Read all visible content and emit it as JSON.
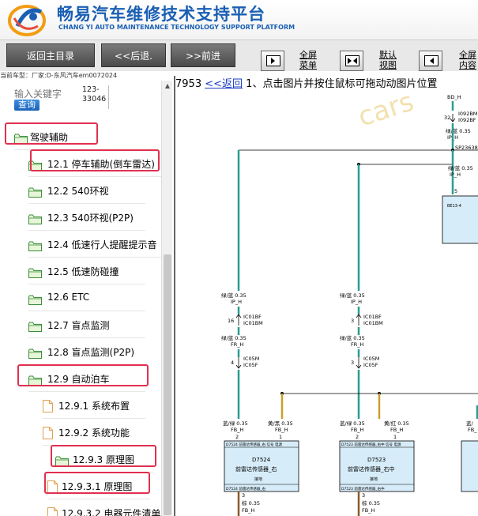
{
  "header": {
    "title_cn": "畅易汽车维修技术支持平台",
    "title_en": "CHANG YI AUTO MAINTENANCE TECHNOLOGY SUPPORT PLATFORM"
  },
  "toolbar": {
    "main_menu": "返回主目录",
    "back": "<<后退.",
    "forward": ">>前进",
    "full_menu": [
      "全屏",
      "菜单"
    ],
    "default_view": [
      "默认",
      "视图"
    ],
    "full_content": [
      "全屏",
      "内容"
    ]
  },
  "car_info": "当前车型：厂家:D-东风汽车em0072024",
  "search": {
    "placeholder": "输入关键字",
    "button": "查询",
    "note": "123-33046"
  },
  "tree": [
    {
      "label": "驾驶辅助",
      "highlight": true
    },
    {
      "label": "12.1 停车辅助(倒车雷达)",
      "highlight": true
    },
    {
      "label": "12.2 540环视",
      "highlight": false
    },
    {
      "label": "12.3 540环视(P2P)",
      "highlight": false
    },
    {
      "label": "12.4 低速行人提醒提示音",
      "highlight": false
    },
    {
      "label": "12.5 低速防碰撞",
      "highlight": false
    },
    {
      "label": "12.6 ETC",
      "highlight": false
    },
    {
      "label": "12.7 盲点监测",
      "highlight": false
    },
    {
      "label": "12.8 盲点监测(P2P)",
      "highlight": false
    },
    {
      "label": "12.9 自动泊车",
      "highlight": true
    },
    {
      "label": "12.9.1 系统布置",
      "highlight": false
    },
    {
      "label": "12.9.2 系统功能",
      "highlight": false
    },
    {
      "label": "12.9.3 原理图",
      "highlight": true
    },
    {
      "label": "12.9.3.1 原理图",
      "highlight": true
    },
    {
      "label": "12.9.3.2 电器元件清单",
      "highlight": false
    }
  ],
  "main": {
    "page_num": "7953",
    "back_link": "<<返回",
    "instruction": "1、点击图片并按住鼠标可拖动动图片位置"
  },
  "diagram": {
    "watermark": "cars",
    "top_labels": [
      "BD_H",
      "32",
      "I092BM",
      "I092BF",
      "绿/蓝 0.35",
      "IP_H",
      "SP23638"
    ],
    "ecu_labels": [
      "绿/蓝 0.35",
      "IP_H",
      "5",
      "BE13-4"
    ],
    "left_wire": [
      "绿/蓝 0.35",
      "IP_H",
      "16",
      "IC01BF",
      "IC01BM",
      "绿/蓝 0.35",
      "FR_H",
      "4",
      "IC05M",
      "IC05F"
    ],
    "mid_wire": [
      "绿/蓝 0.35",
      "IP_H",
      "3",
      "IC01BF",
      "IC01BM",
      "绿/蓝 0.35",
      "FR_H",
      "3",
      "IC05M",
      "IC05F"
    ],
    "lower_left": [
      "蓝/绿 0.35",
      "FB_H",
      "2",
      "黄/黑 0.35",
      "FB_H",
      "1"
    ],
    "lower_mid": [
      "蓝/绿 0.35",
      "FB_H",
      "2",
      "黄/红 0.35",
      "FB_H",
      "1"
    ],
    "lower_right": [
      "蓝/",
      "FB_"
    ],
    "sensor_left": {
      "header": "D7524 前雷达传感器_右 信号 电源",
      "id": "D7524",
      "name": "前雷达传感器_右",
      "ground": "接地",
      "footer": "D7524 前雷达传感器_右"
    },
    "sensor_mid": {
      "header": "D7523 前雷达传感器_右中 信号 电源",
      "id": "D7523",
      "name": "前雷达传感器_右中",
      "ground": "接地",
      "footer": "D7523 前雷达传感器_右中"
    },
    "bottom_left": [
      "3",
      "棕 0.35",
      "FB_H"
    ],
    "bottom_mid": [
      "3",
      "棕 0.35",
      "FB_H"
    ],
    "colors": {
      "teal_wire": "#2a9d8f",
      "yellow_wire": "#c8a02a",
      "brown_wire": "#8b5a2b",
      "box_fill": "#d6ecf8",
      "highlight": "#e0304f"
    }
  }
}
